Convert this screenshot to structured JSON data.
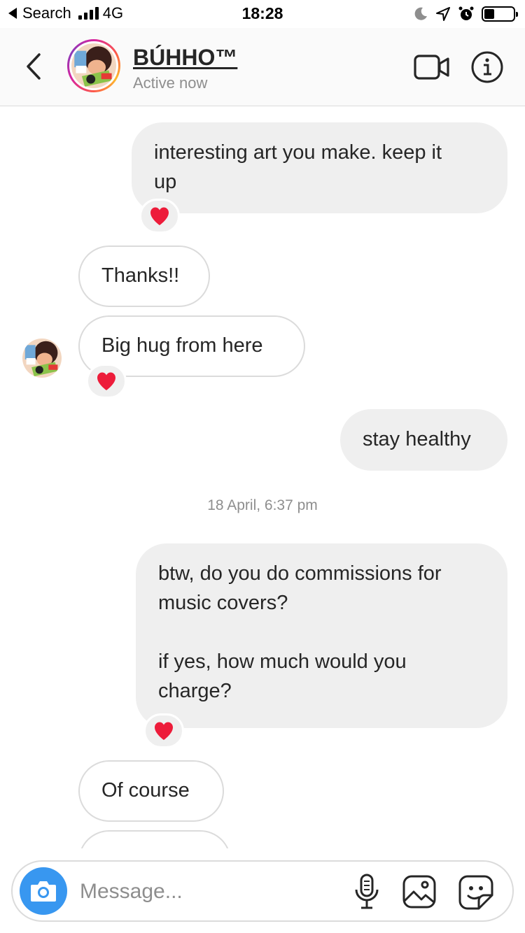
{
  "status_bar": {
    "back_app": "Search",
    "network": "4G",
    "time": "18:28",
    "battery_level": 0.35
  },
  "header": {
    "name": "BÚHHO™",
    "status": "Active now",
    "back_icon": "chevron-left-icon",
    "video_icon": "video-camera-icon",
    "info_icon": "info-icon"
  },
  "messages": [
    {
      "direction": "out",
      "text": "interesting art you make. keep it\nup",
      "reaction": "❤️"
    },
    {
      "direction": "in",
      "text": "Thanks!!"
    },
    {
      "direction": "in",
      "text": "Big hug from here",
      "reaction": "❤️"
    },
    {
      "direction": "out",
      "text": "stay healthy"
    },
    {
      "type": "timestamp",
      "text": "18 April, 6:37 pm"
    },
    {
      "direction": "out",
      "text": "btw, do you do commissions for\nmusic covers?\n\nif yes, how much would you\ncharge?",
      "reaction": "❤️"
    },
    {
      "direction": "in",
      "text": "Of course"
    },
    {
      "direction": "in",
      "text": ""
    }
  ],
  "composer": {
    "placeholder": "Message...",
    "camera_icon": "camera-icon",
    "mic_icon": "microphone-icon",
    "gallery_icon": "image-icon",
    "sticker_icon": "sticker-icon"
  },
  "colors": {
    "accent": "#3897f0",
    "bubble_out": "#efefef",
    "bubble_in_border": "#dbdbdb",
    "heart": "#ed1c3a"
  }
}
